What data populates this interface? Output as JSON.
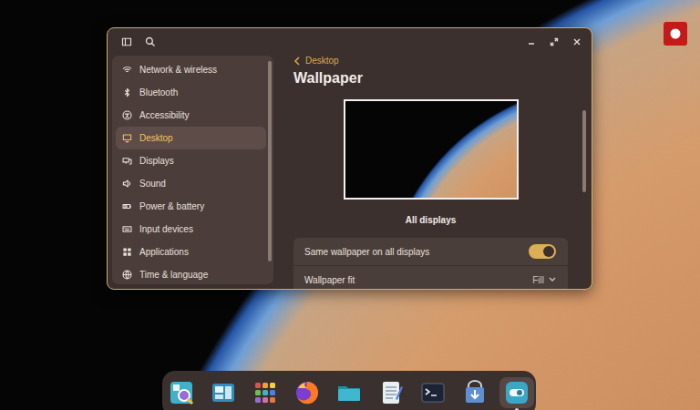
{
  "window": {
    "title": "Wallpaper",
    "back": "Desktop"
  },
  "screen_recording": true,
  "sidebar": {
    "items": [
      {
        "label": "Network & wireless",
        "selected": false
      },
      {
        "label": "Bluetooth",
        "selected": false
      },
      {
        "label": "Accessibility",
        "selected": false
      },
      {
        "label": "Desktop",
        "selected": true
      },
      {
        "label": "Displays",
        "selected": false
      },
      {
        "label": "Sound",
        "selected": false
      },
      {
        "label": "Power & battery",
        "selected": false
      },
      {
        "label": "Input devices",
        "selected": false
      },
      {
        "label": "Applications",
        "selected": false
      },
      {
        "label": "Time & language",
        "selected": false
      }
    ]
  },
  "preview": {
    "label": "All displays"
  },
  "settings": [
    {
      "label": "Same wallpaper on all displays",
      "kind": "toggle",
      "on": true
    },
    {
      "label": "Wallpaper fit",
      "kind": "select",
      "value": "Fill"
    }
  ],
  "dock": [
    {
      "active": false
    },
    {
      "active": false
    },
    {
      "active": false
    },
    {
      "active": false
    },
    {
      "active": false
    },
    {
      "active": false
    },
    {
      "active": false
    },
    {
      "active": false
    },
    {
      "active": true
    }
  ]
}
